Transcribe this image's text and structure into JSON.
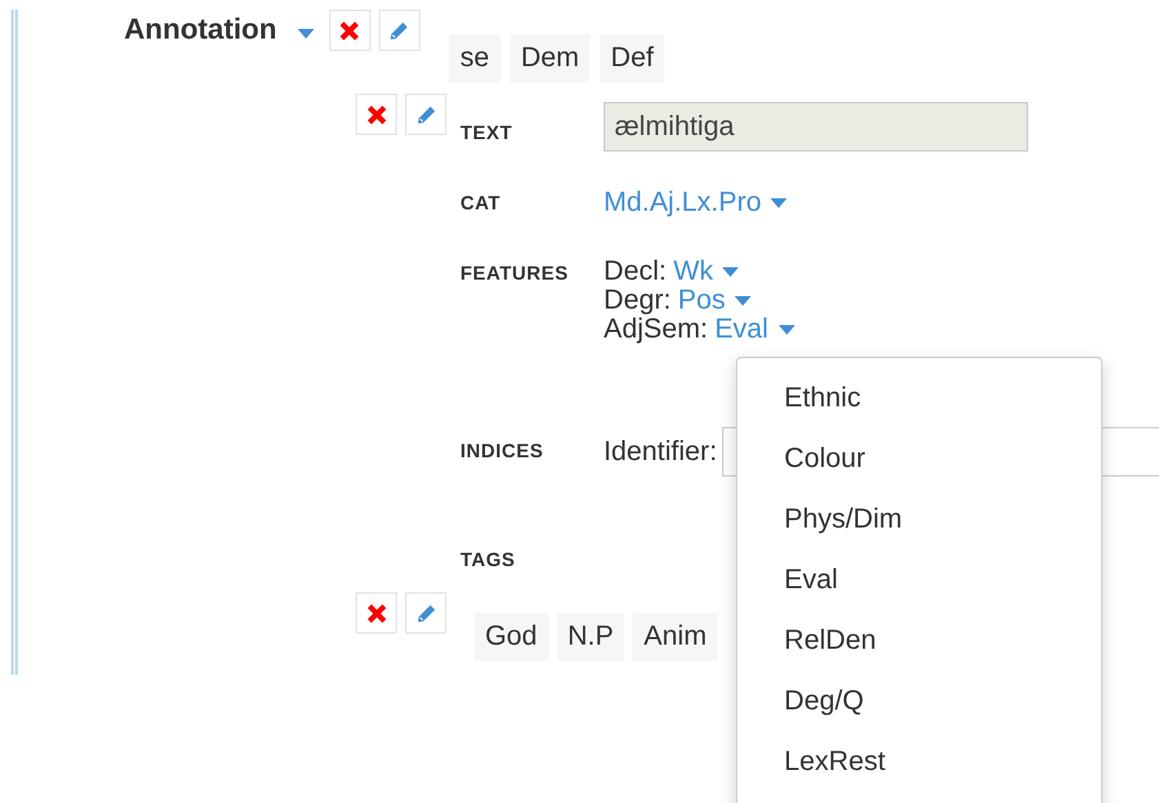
{
  "annotation": {
    "title": "Annotation",
    "expanded": true,
    "tags": [
      {
        "label": "se"
      },
      {
        "label": "Dem"
      },
      {
        "label": "Def"
      }
    ]
  },
  "token": {
    "fields": [
      {
        "kind": "text",
        "label": "TEXT",
        "value": "ælmihtiga"
      },
      {
        "kind": "select",
        "label": "CAT",
        "value": "Md.Aj.Lx.Pro"
      },
      {
        "kind": "features",
        "label": "FEATURES",
        "features": [
          {
            "name": "Decl:",
            "value": "Wk"
          },
          {
            "name": "Degr:",
            "value": "Pos"
          },
          {
            "name": "AdjSem:",
            "value": "Eval"
          }
        ]
      },
      {
        "kind": "indices",
        "label": "INDICES",
        "indices": [
          {
            "name": "Identifier:"
          }
        ]
      },
      {
        "kind": "tags",
        "label": "TAGS"
      }
    ]
  },
  "word_tags": [
    {
      "label": "God"
    },
    {
      "label": "N.P"
    },
    {
      "label": "Anim"
    }
  ],
  "dropdown_menu": {
    "items": [
      {
        "label": "Ethnic"
      },
      {
        "label": "Colour"
      },
      {
        "label": "Phys/Dim"
      },
      {
        "label": "Eval"
      },
      {
        "label": "RelDen"
      },
      {
        "label": "Deg/Q"
      },
      {
        "label": "LexRest"
      }
    ]
  }
}
